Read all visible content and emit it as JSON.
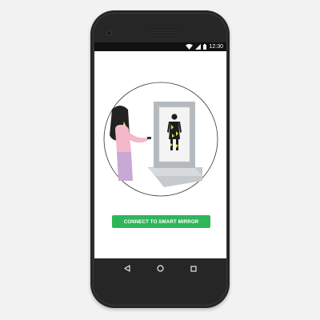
{
  "status_bar": {
    "time": "12:30",
    "icons": [
      "wifi-icon",
      "cell-signal-icon",
      "battery-icon"
    ]
  },
  "illustration": {
    "description_icon": "woman-using-smart-mirror-illustration"
  },
  "main": {
    "connect_label": "CONNECT TO SMART MIRROR",
    "connect_color": "#2fb55a"
  },
  "nav_bar": {
    "buttons": [
      "back-icon",
      "home-icon",
      "recents-icon"
    ]
  },
  "colors": {
    "phone_body": "#262626",
    "screen_bg": "#ffffff",
    "background": "#f2f2f2",
    "hair": "#222222",
    "top": "#f4b8c8",
    "pants": "#c9a8d6",
    "kiosk": "#a9afb4"
  }
}
